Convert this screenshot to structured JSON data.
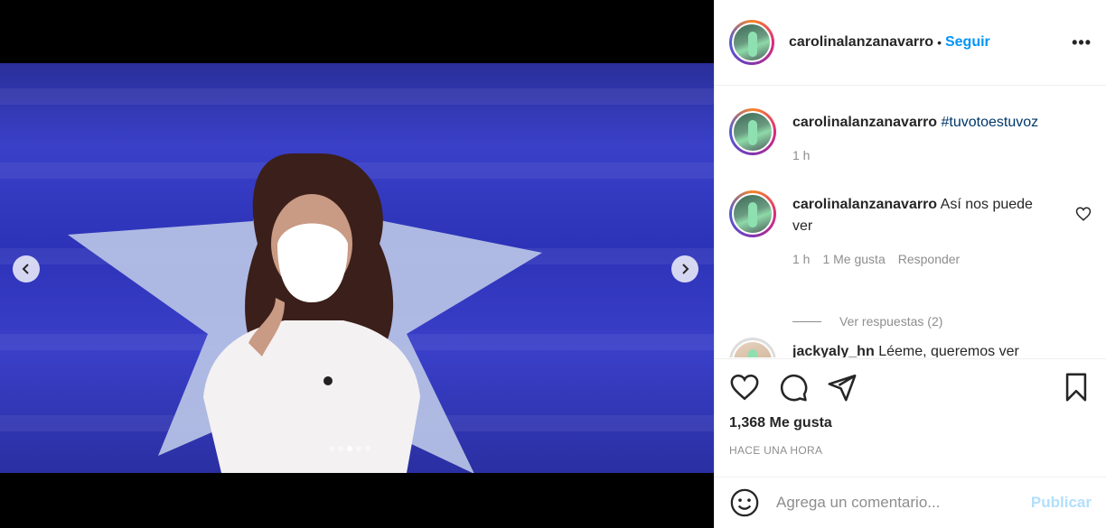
{
  "post": {
    "username": "carolinalanzanavarro",
    "follow_label": "Seguir",
    "more_label": "•••",
    "dot_separator": "•"
  },
  "comments": [
    {
      "username": "carolinalanzanavarro",
      "text": "#tuvotoestuvoz",
      "time": "1 h"
    },
    {
      "username": "carolinalanzanavarro",
      "text": "Así nos puede ver",
      "time": "1 h",
      "likes": "1 Me gusta",
      "reply": "Responder",
      "view_replies": "Ver respuestas (2)"
    },
    {
      "username": "jackyaly_hn",
      "text": "Léeme, queremos ver"
    }
  ],
  "actions": {
    "likes": "1,368 Me gusta",
    "time": "HACE UNA HORA"
  },
  "composer": {
    "placeholder": "Agrega un comentario...",
    "publish_label": "Publicar"
  },
  "carousel": {
    "slide_count": 5,
    "active_index": 2
  },
  "colors": {
    "accent": "#0095f6",
    "publish_disabled": "#b2dffc",
    "hashtag": "#00376b",
    "muted": "#8e8e8e"
  }
}
